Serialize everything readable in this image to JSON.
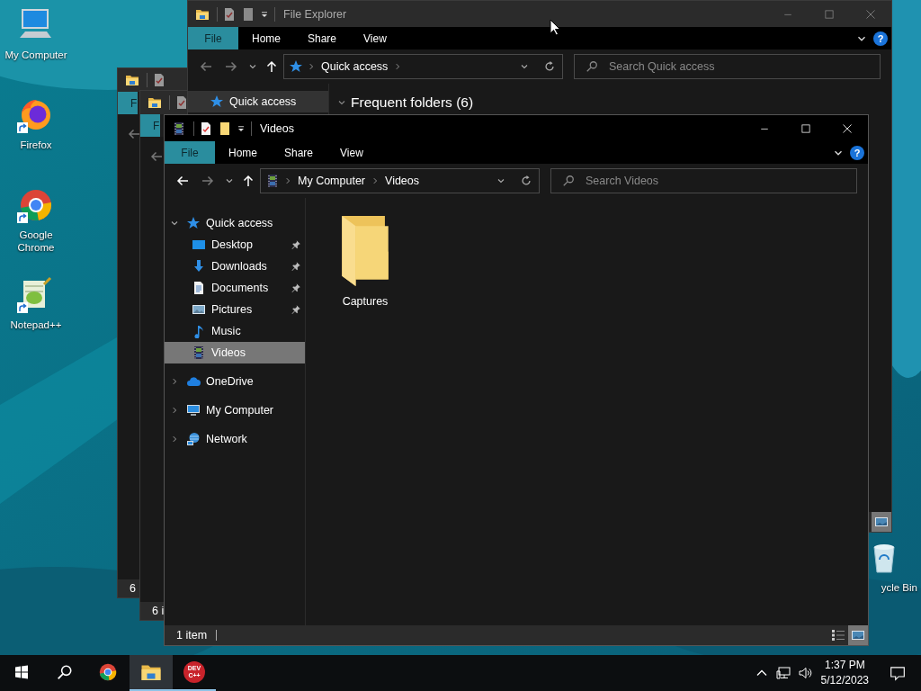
{
  "desktop_icons": [
    {
      "kind": "computer",
      "label": "My Computer",
      "shortcut": false
    },
    {
      "kind": "firefox",
      "label": "Firefox",
      "shortcut": true
    },
    {
      "kind": "chrome",
      "label": "Google Chrome",
      "shortcut": true
    },
    {
      "kind": "notepad",
      "label": "Notepad++",
      "shortcut": true
    },
    {
      "kind": "recycle",
      "label": "ycle Bin",
      "shortcut": false
    }
  ],
  "windows": [
    {
      "kind": "stub",
      "tab": "F",
      "status": "6"
    },
    {
      "kind": "stub",
      "tab": "F",
      "status": "6 i"
    },
    {
      "kind": "quick_access",
      "active": false,
      "title": "File Explorer",
      "help_label": "?",
      "tabs": [
        {
          "label": "File",
          "selected": true
        },
        {
          "label": "Home",
          "selected": false
        },
        {
          "label": "Share",
          "selected": false
        },
        {
          "label": "View",
          "selected": false
        }
      ],
      "back_enabled": false,
      "forward_enabled": false,
      "address": [
        "Quick access"
      ],
      "trailing_chevron": true,
      "search_placeholder": "Search Quick access",
      "nav_tree": [
        {
          "kind": "star",
          "label": "Quick access",
          "selected": true
        }
      ],
      "section": "Frequent folders (6)",
      "view_buttons": [
        {
          "kind": "large_icons",
          "selected": true
        }
      ]
    },
    {
      "kind": "videos",
      "active": true,
      "title": "Videos",
      "help_label": "?",
      "tabs": [
        {
          "label": "File",
          "selected": true
        },
        {
          "label": "Home",
          "selected": false
        },
        {
          "label": "Share",
          "selected": false
        },
        {
          "label": "View",
          "selected": false
        }
      ],
      "back_enabled": true,
      "forward_enabled": false,
      "address": [
        "My Computer",
        "Videos"
      ],
      "trailing_chevron": false,
      "search_placeholder": "Search Videos",
      "nav_tree": [
        {
          "kind": "star",
          "label": "Quick access",
          "expanded": true,
          "selected": false,
          "children": [
            {
              "kind": "desktop",
              "label": "Desktop",
              "pinned": true,
              "selected": false
            },
            {
              "kind": "downloads",
              "label": "Downloads",
              "pinned": true,
              "selected": false
            },
            {
              "kind": "documents",
              "label": "Documents",
              "pinned": true,
              "selected": false
            },
            {
              "kind": "pictures",
              "label": "Pictures",
              "pinned": true,
              "selected": false
            },
            {
              "kind": "music",
              "label": "Music",
              "pinned": false,
              "selected": false
            },
            {
              "kind": "videos",
              "label": "Videos",
              "pinned": false,
              "selected": true
            }
          ]
        },
        {
          "kind": "onedrive",
          "label": "OneDrive",
          "expanded": false,
          "selected": false
        },
        {
          "kind": "computer",
          "label": "My Computer",
          "expanded": false,
          "selected": false
        },
        {
          "kind": "network",
          "label": "Network",
          "expanded": false,
          "selected": false
        }
      ],
      "items": [
        {
          "kind": "folder",
          "label": "Captures"
        }
      ],
      "status": "1 item",
      "view_buttons": [
        {
          "kind": "details",
          "selected": false
        },
        {
          "kind": "large_icons",
          "selected": true
        }
      ]
    }
  ],
  "taskbar": {
    "apps": [
      {
        "kind": "chrome",
        "running": false,
        "active": false
      },
      {
        "kind": "explorer",
        "running": true,
        "active": true
      },
      {
        "kind": "devcpp",
        "running": true,
        "active": false,
        "logo_lines": [
          "DEV",
          "C++"
        ]
      }
    ],
    "time": "1:37 PM",
    "date": "5/12/2023"
  }
}
